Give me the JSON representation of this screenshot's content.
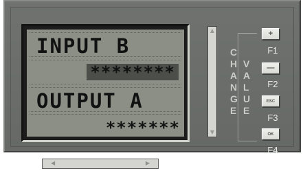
{
  "display": {
    "line1": "INPUT B",
    "line2": "********",
    "line3": "OUTPUT A",
    "line4": "*******"
  },
  "labels": {
    "change": [
      "C",
      "H",
      "A",
      "N",
      "G",
      "E"
    ],
    "value": [
      "V",
      "A",
      "L",
      "U",
      "E"
    ]
  },
  "buttons": {
    "f1": "+",
    "f2": "—",
    "f3": "ESC",
    "f4": "OK"
  },
  "captions": {
    "f1": "F1",
    "f2": "F2",
    "f3": "F3",
    "f4": "F4"
  },
  "scrollbars": {
    "up": "▲",
    "down": "▼",
    "left": "◀",
    "right": "▶"
  },
  "colors": {
    "panel": "#6f726e",
    "lcd": "#8b8f85",
    "button": "#eff0ec",
    "text": "#111111"
  }
}
